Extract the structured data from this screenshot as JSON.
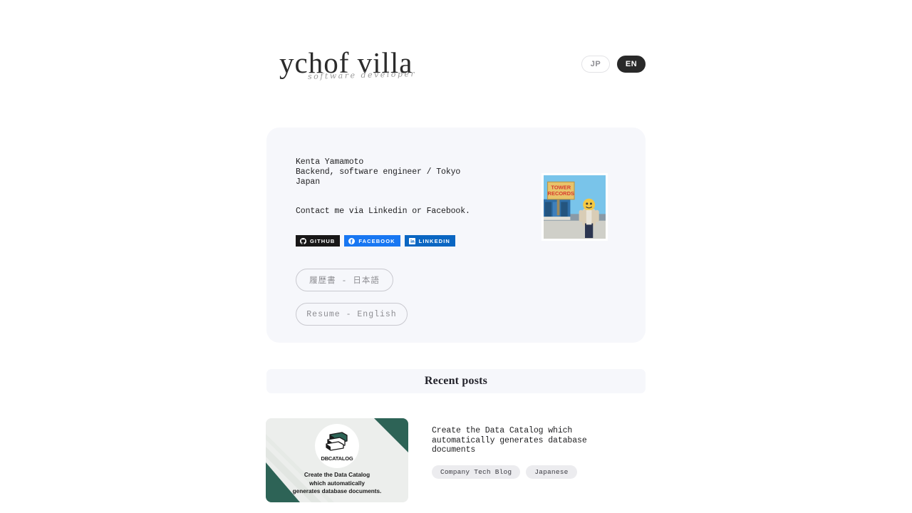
{
  "header": {
    "logo_main": "ychof villa",
    "logo_sub": "software developer",
    "lang_inactive": "JP",
    "lang_active": "EN"
  },
  "profile": {
    "info": "Kenta Yamamoto\nBackend, software engineer / Tokyo\nJapan",
    "contact": "Contact me via Linkedin or Facebook.",
    "badges": [
      {
        "label": "GITHUB",
        "icon": "github-icon",
        "color": "#181717"
      },
      {
        "label": "FACEBOOK",
        "icon": "facebook-icon",
        "color": "#1877F2"
      },
      {
        "label": "LINKEDIN",
        "icon": "linkedin-icon",
        "color": "#0A66C2"
      }
    ],
    "resume_jp": "履歴書 - 日本語",
    "resume_en": "Resume - English",
    "photo_alt": "Person in front of Tower Records sign",
    "photo_sign_line1": "TOWER",
    "photo_sign_line2": "RECORDS"
  },
  "recent": {
    "title": "Recent posts"
  },
  "posts": [
    {
      "title": "Create the Data Catalog which automatically generates database documents",
      "thumb_logo_text": "DBCATALOG",
      "thumb_caption": "Create the Data Catalog\nwhich automatically\ngenerates database documents.",
      "thumb_accent": "#2D6356",
      "tags": [
        "Company Tech Blog",
        "Japanese"
      ]
    }
  ]
}
